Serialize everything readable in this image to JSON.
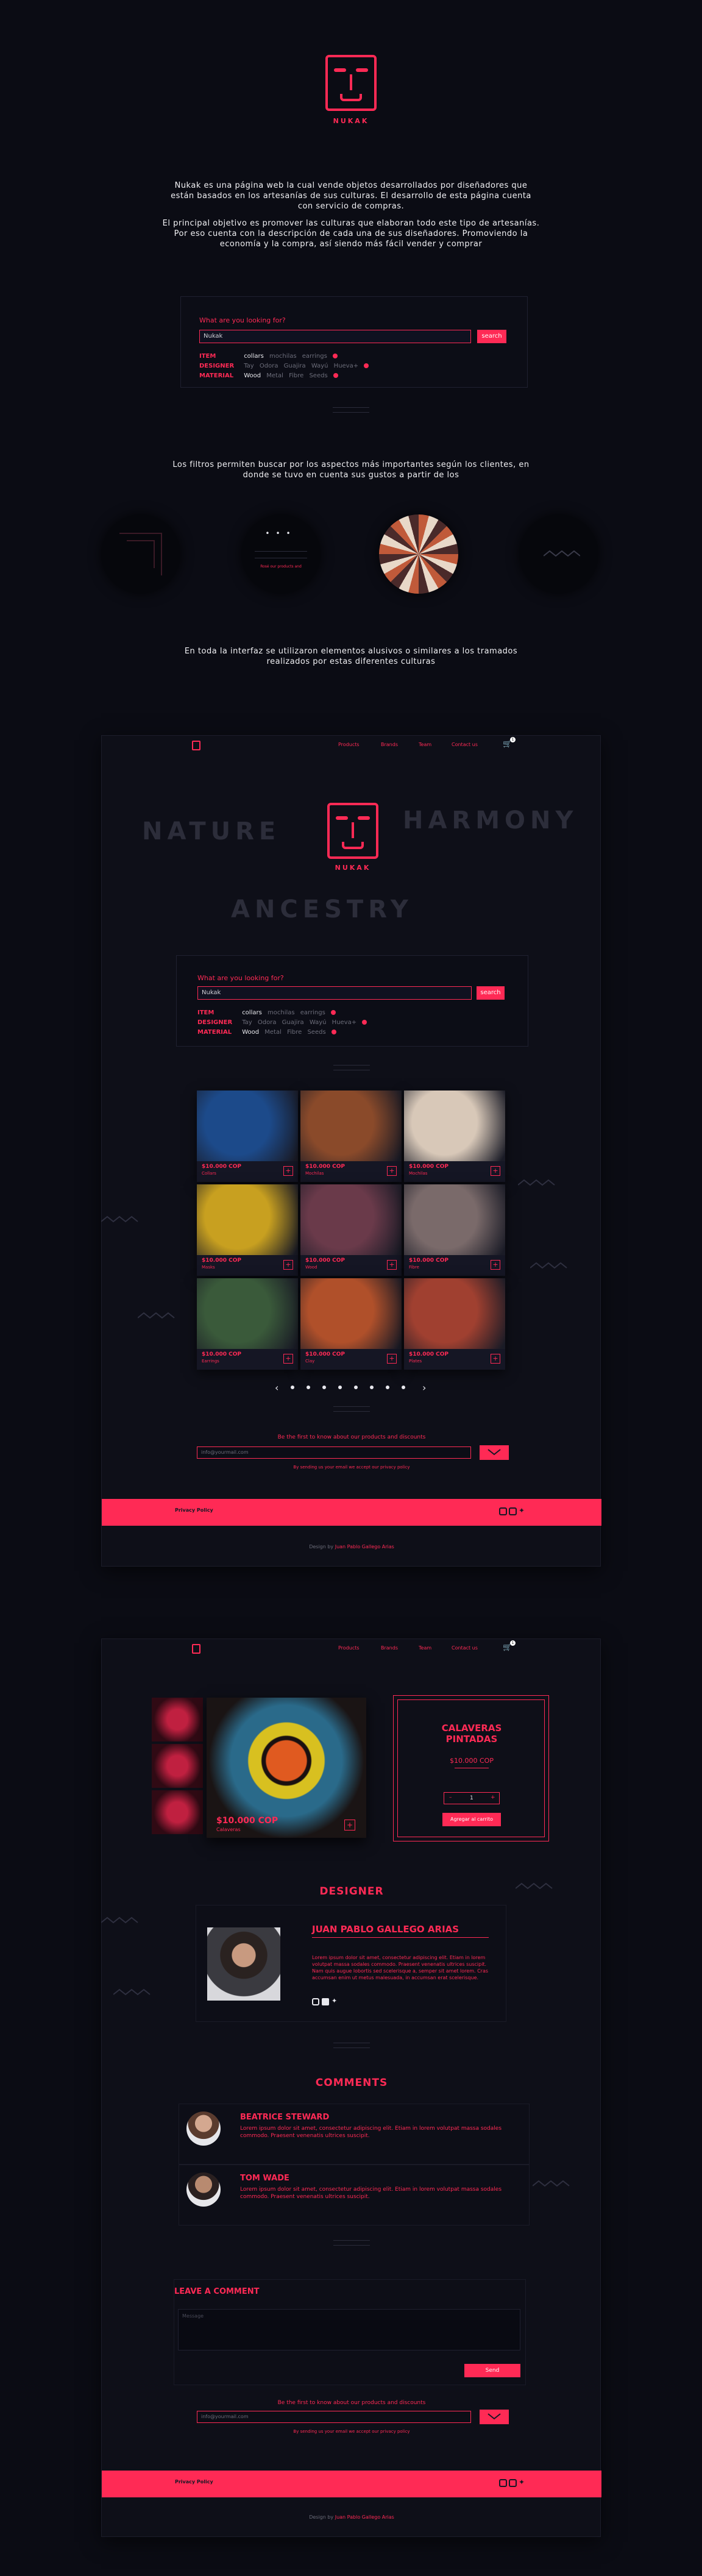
{
  "intro": {
    "brand": "NUKAK",
    "paragraph1": "Nukak es una página web la cual vende objetos desarrollados por diseñadores que están basados en los artesanías de sus culturas. El desarrollo de esta página cuenta con servicio de compras.",
    "paragraph2": "El principal objetivo es promover las culturas que elaboran todo este tipo de artesanías. Por eso cuenta con la descripción de cada una de sus diseñadores. Promoviendo la economía y la compra, así siendo más fácil vender y comprar",
    "filters_text": "Los filtros permiten buscar por los aspectos más importantes según los clientes, en donde se tuvo en cuenta sus gustos a partir de los",
    "patterns_text": "En toda la interfaz se utilizaron elementos alusivos o similares a los tramados realizados por estas diferentes culturas"
  },
  "search": {
    "question": "What are you looking for?",
    "input_value": "Nukak",
    "button": "search",
    "filters": [
      {
        "label": "ITEM",
        "options": [
          "collars",
          "mochilas",
          "earrings"
        ]
      },
      {
        "label": "DESIGNER",
        "options": [
          "Tay",
          "Odora",
          "Guajira",
          "Wayú",
          "Hueva+"
        ]
      },
      {
        "label": "MATERIAL",
        "options": [
          "Wood",
          "Metal",
          "Fibre",
          "Seeds"
        ]
      }
    ]
  },
  "nav": {
    "items": [
      "Products",
      "Brands",
      "Team",
      "Contact us"
    ],
    "cart_count": "1"
  },
  "hero": {
    "words": [
      "NATURE",
      "HARMONY",
      "ANCESTRY"
    ]
  },
  "products": [
    {
      "price": "$10.000 COP",
      "sub": "Collars",
      "color": "#1c4a8a"
    },
    {
      "price": "$10.000 COP",
      "sub": "Mochilas",
      "color": "#8a4a2a"
    },
    {
      "price": "$10.000 COP",
      "sub": "Mochilas",
      "color": "#d8c8b8"
    },
    {
      "price": "$10.000 COP",
      "sub": "Masks",
      "color": "#c8a020"
    },
    {
      "price": "$10.000 COP",
      "sub": "Wood",
      "color": "#6a3a4a"
    },
    {
      "price": "$10.000 COP",
      "sub": "Fibre",
      "color": "#7a6a6a"
    },
    {
      "price": "$10.000 COP",
      "sub": "Earrings",
      "color": "#3a5a3a"
    },
    {
      "price": "$10.000 COP",
      "sub": "Clay",
      "color": "#b0502a"
    },
    {
      "price": "$10.000 COP",
      "sub": "Plates",
      "color": "#a04030"
    }
  ],
  "pager": {
    "prev": "‹",
    "next": "›"
  },
  "newsletter": {
    "text": "Be the first to know about our products and discounts",
    "placeholder": "info@yourmail.com",
    "note": "By sending us your email we accept our privacy policy"
  },
  "footer": {
    "privacy": "Privacy Policy",
    "credit_prefix": "Design by",
    "credit_name": "Juan Pablo Gallego Arias"
  },
  "detail": {
    "title": "CALAVERAS PINTADAS",
    "price": "$10.000 COP",
    "image_price": "$10.000 COP",
    "image_sub": "Calaveras",
    "qty": "1",
    "add_button": "Agregar al carrito",
    "designer_heading": "DESIGNER",
    "designer_name": "JUAN PABLO GALLEGO ARIAS",
    "designer_bio": "Lorem ipsum dolor sit amet, consectetur adipiscing elit. Etiam in lorem volutpat massa sodales commodo. Praesent venenatis ultrices suscipit. Nam quis augue lobortis sed scelerisque a, semper sit amet lorem. Cras accumsan enim ut metus malesuada, in accumsan erat scelerisque.",
    "comments_heading": "COMMENTS",
    "comments": [
      {
        "name": "BEATRICE STEWARD",
        "text": "Lorem ipsum dolor sit amet, consectetur adipiscing elit. Etiam in lorem volutpat massa sodales commodo. Praesent venenatis ultrices suscipit."
      },
      {
        "name": "TOM WADE",
        "text": "Lorem ipsum dolor sit amet, consectetur adipiscing elit. Etiam in lorem volutpat massa sodales commodo. Praesent venenatis ultrices suscipit."
      }
    ],
    "leave_heading": "LEAVE A COMMENT",
    "leave_placeholder": "Message",
    "send": "Send"
  },
  "colors": {
    "accent": "#ff2a55",
    "bg": "#0b0c14"
  }
}
